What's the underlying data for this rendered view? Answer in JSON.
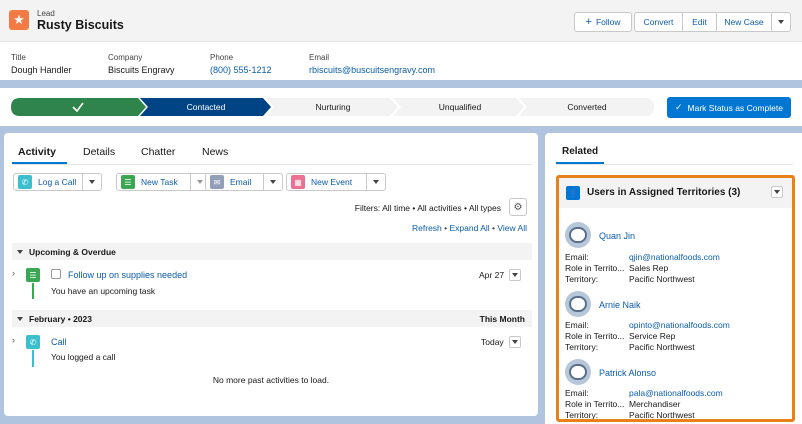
{
  "header": {
    "object_type": "Lead",
    "record_name": "Rusty Biscuits",
    "actions": {
      "follow": "Follow",
      "convert": "Convert",
      "edit": "Edit",
      "new_case": "New Case"
    },
    "fields": [
      {
        "label": "Title",
        "value": "Dough Handler"
      },
      {
        "label": "Company",
        "value": "Biscuits Engravy"
      },
      {
        "label": "Phone",
        "value": "(800) 555-1212"
      },
      {
        "label": "Email",
        "value": "rbiscuits@buscuitsengravy.com"
      }
    ]
  },
  "path": {
    "steps": [
      "",
      "Contacted",
      "Nurturing",
      "Unqualified",
      "Converted"
    ],
    "mark_complete": "Mark Status as Complete"
  },
  "activity": {
    "tabs": [
      "Activity",
      "Details",
      "Chatter",
      "News"
    ],
    "buttons": {
      "log_call": "Log a Call",
      "new_task": "New Task",
      "email": "Email",
      "new_event": "New Event"
    },
    "filters": "Filters: All time • All activities • All types",
    "refresh": "Refresh",
    "expand_all": "Expand All",
    "view_all": "View All",
    "upcoming_header": "Upcoming & Overdue",
    "task": {
      "title": "Follow up on supplies needed",
      "date": "Apr 27",
      "desc": "You have an upcoming task"
    },
    "month_header": "February • 2023",
    "month_label": "This Month",
    "call": {
      "title": "Call",
      "date": "Today",
      "desc": "You logged a call"
    },
    "no_more": "No more past activities to load."
  },
  "related": {
    "tab": "Related",
    "card_title": "Users in Assigned Territories (3)",
    "labels": {
      "email": "Email:",
      "role": "Role in Territo...",
      "territory": "Territory:"
    },
    "users": [
      {
        "name": "Quan Jin",
        "email": "qjin@nationalfoods.com",
        "role": "Sales Rep",
        "territory": "Pacific Northwest"
      },
      {
        "name": "Arnie Naik",
        "email": "opinto@nationalfoods.com",
        "role": "Service Rep",
        "territory": "Pacific Northwest"
      },
      {
        "name": "Patrick Alonso",
        "email": "pala@nationalfoods.com",
        "role": "Merchandiser",
        "territory": "Pacific Northwest"
      }
    ]
  },
  "colors": {
    "brand": "#0176d3",
    "path_complete": "#2e844a",
    "path_current": "#014486",
    "highlight": "#e8811a",
    "lead_icon": "#f27b45"
  }
}
